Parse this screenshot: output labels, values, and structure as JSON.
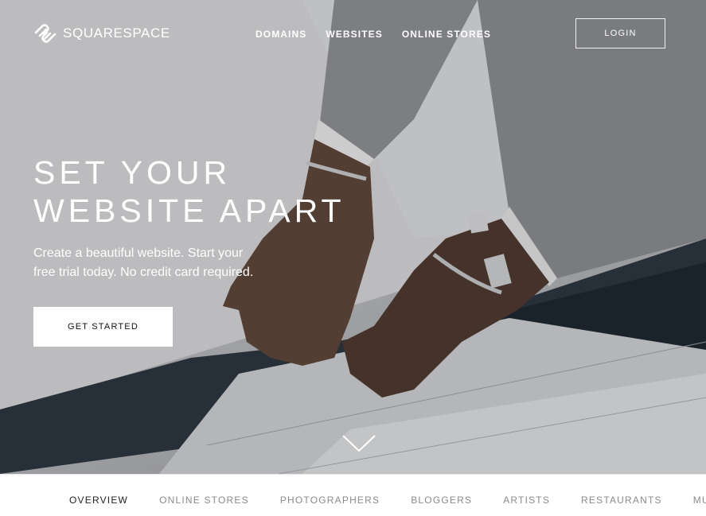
{
  "header": {
    "logo_text": "SQUARESPACE",
    "nav": [
      {
        "label": "DOMAINS"
      },
      {
        "label": "WEBSITES"
      },
      {
        "label": "ONLINE STORES"
      }
    ],
    "login_label": "LOGIN"
  },
  "hero": {
    "headline_line1": "SET YOUR",
    "headline_line2": "WEBSITE APART",
    "subtext_line1": "Create a beautiful website. Start your",
    "subtext_line2": "free trial today. No credit card required.",
    "cta_label": "GET STARTED",
    "scroll_icon": "chevron-down-icon"
  },
  "subnav": {
    "tabs": [
      {
        "label": "OVERVIEW",
        "active": true
      },
      {
        "label": "ONLINE STORES"
      },
      {
        "label": "PHOTOGRAPHERS"
      },
      {
        "label": "BLOGGERS"
      },
      {
        "label": "ARTISTS"
      },
      {
        "label": "RESTAURANTS"
      },
      {
        "label": "MUS"
      }
    ]
  },
  "colors": {
    "hero_text": "#ffffff",
    "cta_bg": "#ffffff",
    "active_tab": "#222222",
    "inactive_tab": "#8a8a8a"
  }
}
